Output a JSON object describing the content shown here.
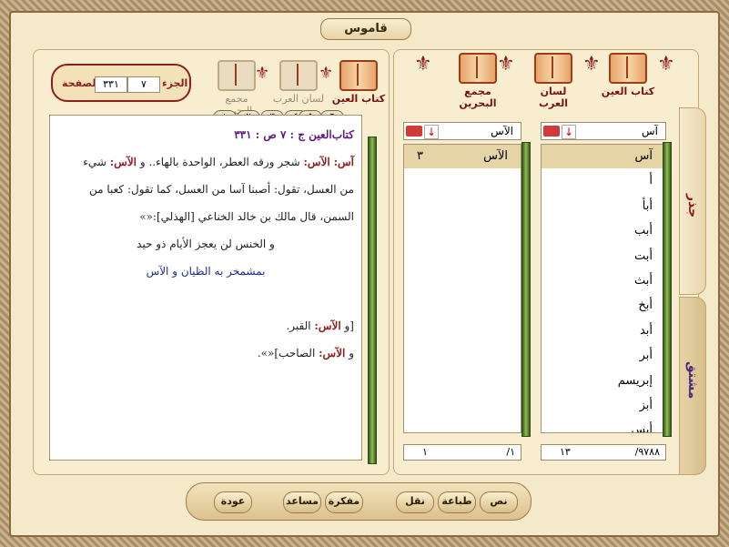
{
  "window": {
    "title": "قاموس"
  },
  "books_right": [
    {
      "label": "كتاب العين"
    },
    {
      "label": "لسان العرب"
    },
    {
      "label": "مجمع البحرين"
    }
  ],
  "books_left": [
    {
      "label": "كتاب العين"
    },
    {
      "label": "لسان العرب"
    },
    {
      "label": "مجمع البحرين"
    }
  ],
  "location": {
    "part_label": "الجزء",
    "part_value": "٧",
    "page_label": "الصفحة",
    "page_value": "٣٣١"
  },
  "root_column": {
    "header": "آس",
    "rows": [
      "آس",
      "أ",
      "أبأ",
      "أبب",
      "أبت",
      "أبث",
      "أبخ",
      "أبد",
      "أبر",
      "إبريسم",
      "أبز",
      "أبس"
    ],
    "footer_total": "٩٧٨٨/",
    "footer_index": "١٣"
  },
  "derived_column": {
    "header": "الآس",
    "rows": [
      {
        "word": "الآس",
        "num": "٣"
      }
    ],
    "footer_total": "١/",
    "footer_index": "١"
  },
  "side_tabs": {
    "root": "جذر",
    "derived": "مشتق"
  },
  "text_panel": {
    "heading": "كتاب‌العين ج : ٧ ص : ٣٣١",
    "line1_k1": "آس:",
    "line1_k2": "الآس:",
    "line1_a": "شجر ورقه العطر، الواحدة بالهاء.. و",
    "line1_k3": "الآس:",
    "line1_b": "شيء",
    "line2": "من العسل، تقول: أصبنا آسا من العسل، كما تقول: كعبا من",
    "line3": "السمن، قال مالك بن خالد الخناعي [الهذلي]:«»",
    "poem1": "و الخنس لن يعجز الأيام ذو حيد",
    "poem2": "بمشمخر به الظيان و الآس",
    "line4_a": "[و",
    "line4_k": "الآس:",
    "line4_b": "القبر.",
    "line5_a": "و",
    "line5_k": "الآس:",
    "line5_b": "الصاحب]«».",
    "icons": [
      "١",
      "٢",
      "٣",
      "٤",
      "٥",
      "٦"
    ]
  },
  "toolbar": [
    "نص",
    "طباعة",
    "نقل",
    "مفكرة",
    "مساعد",
    "عودة"
  ]
}
